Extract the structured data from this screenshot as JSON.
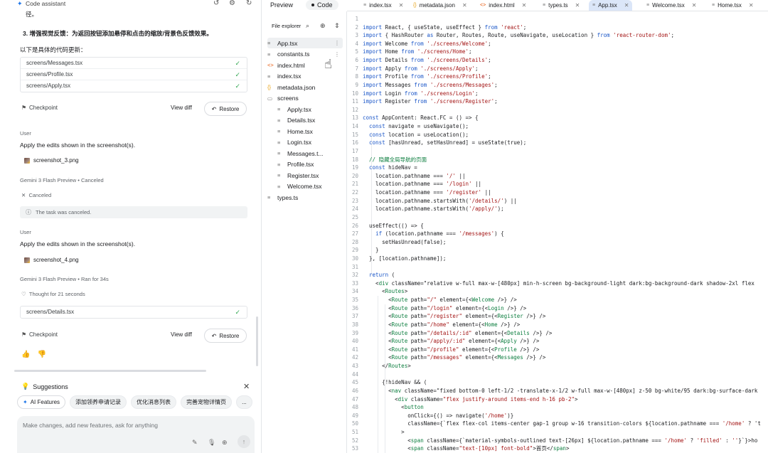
{
  "left_panel": {
    "header_title": "Code assistant",
    "intro_lines": [
      "径。",
      "3. 增强视觉反馈：为返回按钮添加悬停和点击的缩放/背景色反馈效果。",
      "以下是具体的代码更新："
    ],
    "updated_files": [
      "screens/Messages.tsx",
      "screens/Profile.tsx",
      "screens/Apply.tsx"
    ],
    "checkpoint_label": "Checkpoint",
    "view_diff_label": "View diff",
    "restore_label": "Restore",
    "user_label": "User",
    "message_1": "Apply the edits shown in the screenshot(s).",
    "screenshot_1": "screenshot_3.png",
    "model_status_1": "Gemini 3 Flash Preview  •  Canceled",
    "canceled_label": "Canceled",
    "task_canceled_text": "The task was canceled.",
    "message_2": "Apply the edits shown in the screenshot(s).",
    "screenshot_2": "screenshot_4.png",
    "model_status_2": "Gemini 3 Flash Preview  •  Ran for 34s",
    "thought_text": "Thought for 21 seconds",
    "updated_files_2": [
      "screens/Details.tsx"
    ],
    "suggestions_title": "Suggestions",
    "chips": [
      "AI Features",
      "添加领养申请记录",
      "优化消息列表",
      "完善宠物详情页",
      "..."
    ],
    "input_placeholder": "Make changes, add new features, ask for anything"
  },
  "mode_bar": {
    "preview": "Preview",
    "code": "Code"
  },
  "tabs": [
    {
      "label": "index.tsx",
      "type": "tsx",
      "active": false
    },
    {
      "label": "metadata.json",
      "type": "json",
      "active": false
    },
    {
      "label": "index.html",
      "type": "html",
      "active": false
    },
    {
      "label": "types.ts",
      "type": "ts",
      "active": false
    },
    {
      "label": "App.tsx",
      "type": "tsx",
      "active": true
    },
    {
      "label": "Welcome.tsx",
      "type": "tsx",
      "active": false
    },
    {
      "label": "Home.tsx",
      "type": "tsx",
      "active": false
    }
  ],
  "explorer": {
    "title": "File explorer",
    "items": [
      {
        "label": "App.tsx",
        "icon": "lines",
        "selected": true
      },
      {
        "label": "constants.ts",
        "icon": "lines"
      },
      {
        "label": "index.html",
        "icon": "html"
      },
      {
        "label": "index.tsx",
        "icon": "lines"
      },
      {
        "label": "metadata.json",
        "icon": "json"
      },
      {
        "label": "screens",
        "icon": "folder"
      },
      {
        "label": "Apply.tsx",
        "icon": "lines",
        "sub": true
      },
      {
        "label": "Details.tsx",
        "icon": "lines",
        "sub": true
      },
      {
        "label": "Home.tsx",
        "icon": "lines",
        "sub": true
      },
      {
        "label": "Login.tsx",
        "icon": "lines",
        "sub": true
      },
      {
        "label": "Messages.t...",
        "icon": "lines",
        "sub": true
      },
      {
        "label": "Profile.tsx",
        "icon": "lines",
        "sub": true
      },
      {
        "label": "Register.tsx",
        "icon": "lines",
        "sub": true
      },
      {
        "label": "Welcome.tsx",
        "icon": "lines",
        "sub": true
      },
      {
        "label": "types.ts",
        "icon": "lines"
      }
    ]
  },
  "code": [
    "",
    "import React, { useState, useEffect } from 'react';",
    "import { HashRouter as Router, Routes, Route, useNavigate, useLocation } from 'react-router-dom';",
    "import Welcome from './screens/Welcome';",
    "import Home from './screens/Home';",
    "import Details from './screens/Details';",
    "import Apply from './screens/Apply';",
    "import Profile from './screens/Profile';",
    "import Messages from './screens/Messages';",
    "import Login from './screens/Login';",
    "import Register from './screens/Register';",
    "",
    "const AppContent: React.FC = () => {",
    "  const navigate = useNavigate();",
    "  const location = useLocation();",
    "  const [hasUnread, setHasUnread] = useState(true);",
    "",
    "  // 隐藏全局导航的页面",
    "  const hideNav =",
    "    location.pathname === '/' ||",
    "    location.pathname === '/login' ||",
    "    location.pathname === '/register' ||",
    "    location.pathname.startsWith('/details/') ||",
    "    location.pathname.startsWith('/apply/');",
    "",
    "  useEffect(() => {",
    "    if (location.pathname === '/messages') {",
    "      setHasUnread(false);",
    "    }",
    "  }, [location.pathname]);",
    "",
    "  return (",
    "    <div className=\"relative w-full max-w-[480px] min-h-screen bg-background-light dark:bg-background-dark shadow-2xl flex",
    "      <Routes>",
    "        <Route path=\"/\" element={<Welcome />} />",
    "        <Route path=\"/login\" element={<Login />} />",
    "        <Route path=\"/register\" element={<Register />} />",
    "        <Route path=\"/home\" element={<Home />} />",
    "        <Route path=\"/details/:id\" element={<Details />} />",
    "        <Route path=\"/apply/:id\" element={<Apply />} />",
    "        <Route path=\"/profile\" element={<Profile />} />",
    "        <Route path=\"/messages\" element={<Messages />} />",
    "      </Routes>",
    "",
    "      {!hideNav && (",
    "        <nav className=\"fixed bottom-0 left-1/2 -translate-x-1/2 w-full max-w-[480px] z-50 bg-white/95 dark:bg-surface-dark",
    "          <div className=\"flex justify-around items-end h-16 pb-2\">",
    "            <button",
    "              onClick={() => navigate('/home')}",
    "              className={`flex flex-col items-center gap-1 group w-16 transition-colors ${location.pathname === '/home' ? 't",
    "            >",
    "              <span className={`material-symbols-outlined text-[26px] ${location.pathname === '/home' ? 'filled' : ''}`}>ho",
    "              <span className=\"text-[10px] font-bold\">首页</span>"
  ],
  "colors": {
    "keyword": "#1a56c8",
    "string": "#a31515",
    "tag": "#0b7d3e",
    "comment": "#0b7d3e",
    "accent": "#1a73e8",
    "check": "#34a853"
  },
  "icons": {
    "header": [
      "history-icon",
      "settings-icon",
      "refresh-icon"
    ],
    "explorer": [
      "search-icon",
      "add-icon",
      "collapse-icon"
    ],
    "input": [
      "magic-wand-icon",
      "mic-icon",
      "add-circle-icon",
      "send-icon"
    ]
  }
}
